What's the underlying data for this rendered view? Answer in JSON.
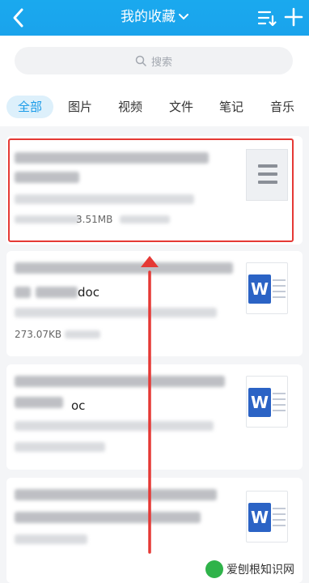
{
  "header": {
    "title": "我的收藏",
    "back_icon": "chevron-left-icon",
    "sort_icon": "sort-list-icon",
    "add_icon": "plus-icon"
  },
  "search": {
    "placeholder": "搜索"
  },
  "tabs": [
    {
      "label": "全部",
      "active": true
    },
    {
      "label": "图片"
    },
    {
      "label": "视频"
    },
    {
      "label": "文件"
    },
    {
      "label": "笔记"
    },
    {
      "label": "音乐"
    }
  ],
  "items": [
    {
      "name_suffix": "",
      "size": "3.51MB",
      "type": "generic-doc"
    },
    {
      "name_suffix": "doc",
      "size": "273.07KB",
      "type": "word"
    },
    {
      "name_suffix": "oc",
      "size": "",
      "type": "word"
    },
    {
      "name_suffix": "",
      "size": "",
      "type": "word"
    }
  ],
  "watermark": {
    "text": "爱刨根知识网"
  },
  "colors": {
    "header": "#1aa9ee",
    "highlight": "#e53935",
    "accent": "#1a9be8",
    "word": "#2b63c5"
  }
}
